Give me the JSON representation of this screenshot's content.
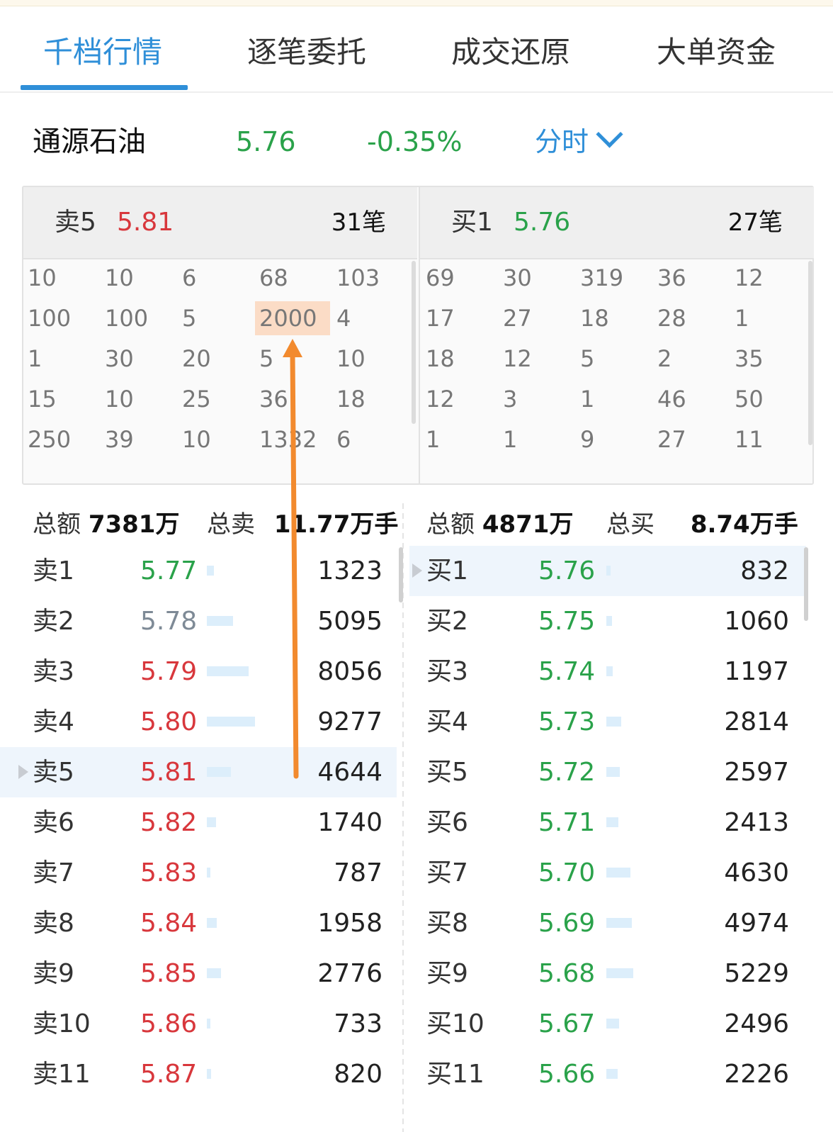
{
  "tabs": [
    {
      "label": "千档行情",
      "active": true
    },
    {
      "label": "逐笔委托",
      "active": false
    },
    {
      "label": "成交还原",
      "active": false
    },
    {
      "label": "大单资金",
      "active": false
    }
  ],
  "stock": {
    "name": "通源石油",
    "price": "5.76",
    "change": "-0.35%",
    "period": "分时"
  },
  "queue": {
    "sell": {
      "label": "卖5",
      "price": "5.81",
      "count": "31笔",
      "rows": [
        [
          "10",
          "10",
          "6",
          "68",
          "103"
        ],
        [
          "100",
          "100",
          "5",
          "2000",
          "4"
        ],
        [
          "1",
          "30",
          "20",
          "5",
          "10"
        ],
        [
          "15",
          "10",
          "25",
          "36",
          "18"
        ],
        [
          "250",
          "39",
          "10",
          "1332",
          "6"
        ]
      ]
    },
    "buy": {
      "label": "买1",
      "price": "5.76",
      "count": "27笔",
      "rows": [
        [
          "69",
          "30",
          "319",
          "36",
          "12"
        ],
        [
          "17",
          "27",
          "18",
          "28",
          "1"
        ],
        [
          "18",
          "12",
          "5",
          "2",
          "35"
        ],
        [
          "12",
          "3",
          "1",
          "46",
          "50"
        ],
        [
          "1",
          "1",
          "9",
          "27",
          "11"
        ]
      ]
    },
    "highlight_value": "2000"
  },
  "summary": {
    "sell": {
      "total_label": "总额",
      "total_value": "7381万",
      "vol_label": "总卖",
      "vol_value": "11.77万手"
    },
    "buy": {
      "total_label": "总额",
      "total_value": "4871万",
      "vol_label": "总买",
      "vol_value": "8.74万手"
    }
  },
  "asks": [
    {
      "label": "卖1",
      "price": "5.77",
      "volume": "1323",
      "color": "green",
      "bar": 0.14
    },
    {
      "label": "卖2",
      "price": "5.78",
      "volume": "5095",
      "color": "gray",
      "bar": 0.55
    },
    {
      "label": "卖3",
      "price": "5.79",
      "volume": "8056",
      "color": "red",
      "bar": 0.87
    },
    {
      "label": "卖4",
      "price": "5.80",
      "volume": "9277",
      "color": "red",
      "bar": 1.0
    },
    {
      "label": "卖5",
      "price": "5.81",
      "volume": "4644",
      "color": "red",
      "bar": 0.5,
      "selected": true
    },
    {
      "label": "卖6",
      "price": "5.82",
      "volume": "1740",
      "color": "red",
      "bar": 0.19
    },
    {
      "label": "卖7",
      "price": "5.83",
      "volume": "787",
      "color": "red",
      "bar": 0.08
    },
    {
      "label": "卖8",
      "price": "5.84",
      "volume": "1958",
      "color": "red",
      "bar": 0.21
    },
    {
      "label": "卖9",
      "price": "5.85",
      "volume": "2776",
      "color": "red",
      "bar": 0.3
    },
    {
      "label": "卖10",
      "price": "5.86",
      "volume": "733",
      "color": "red",
      "bar": 0.08
    },
    {
      "label": "卖11",
      "price": "5.87",
      "volume": "820",
      "color": "red",
      "bar": 0.09
    }
  ],
  "bids": [
    {
      "label": "买1",
      "price": "5.76",
      "volume": "832",
      "color": "green",
      "bar": 0.16,
      "selected": true
    },
    {
      "label": "买2",
      "price": "5.75",
      "volume": "1060",
      "color": "green",
      "bar": 0.2
    },
    {
      "label": "买3",
      "price": "5.74",
      "volume": "1197",
      "color": "green",
      "bar": 0.23
    },
    {
      "label": "买4",
      "price": "5.73",
      "volume": "2814",
      "color": "green",
      "bar": 0.54
    },
    {
      "label": "买5",
      "price": "5.72",
      "volume": "2597",
      "color": "green",
      "bar": 0.5
    },
    {
      "label": "买6",
      "price": "5.71",
      "volume": "2413",
      "color": "green",
      "bar": 0.46
    },
    {
      "label": "买7",
      "price": "5.70",
      "volume": "4630",
      "color": "green",
      "bar": 0.89
    },
    {
      "label": "买8",
      "price": "5.69",
      "volume": "4974",
      "color": "green",
      "bar": 0.95
    },
    {
      "label": "买9",
      "price": "5.68",
      "volume": "5229",
      "color": "green",
      "bar": 1.0
    },
    {
      "label": "买10",
      "price": "5.67",
      "volume": "2496",
      "color": "green",
      "bar": 0.48
    },
    {
      "label": "买11",
      "price": "5.66",
      "volume": "2226",
      "color": "green",
      "bar": 0.43
    }
  ],
  "colors": {
    "accent": "#2f8fd8",
    "up": "#d8373c",
    "down": "#2aa24a",
    "neutral": "#7e8a96",
    "annotation": "#f28a2e",
    "highlight": "#fbdcc6"
  }
}
